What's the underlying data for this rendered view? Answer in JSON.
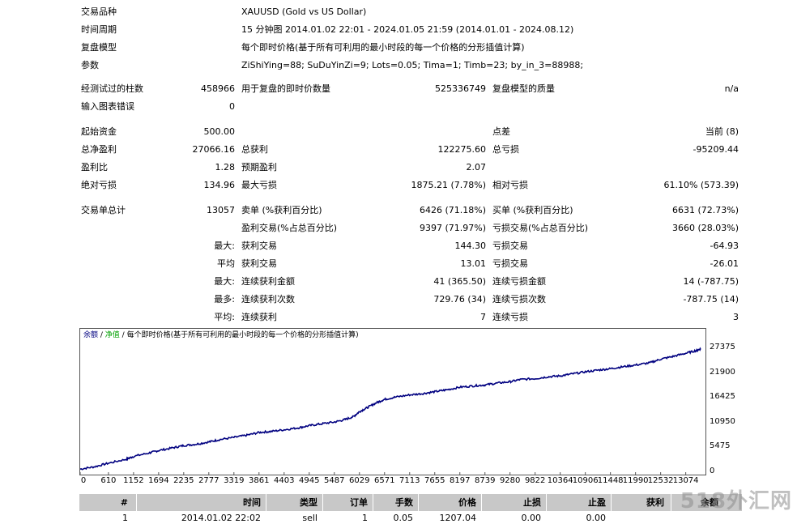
{
  "header": {
    "symbol_label": "交易品种",
    "symbol_value": "XAUUSD (Gold vs US Dollar)",
    "period_label": "时间周期",
    "period_value": "15 分钟图 2014.01.02 22:01 - 2024.01.05 21:59 (2014.01.01 - 2024.08.12)",
    "model_label": "复盘模型",
    "model_value": "每个即时价格(基于所有可利用的最小时段的每一个价格的分形插值计算)",
    "params_label": "参数",
    "params_value": "ZiShiYing=88; SuDuYinZi=9; Lots=0.05; Tima=1; Timb=23; by_in_3=88988;"
  },
  "stats": {
    "bars_label": "经测试过的柱数",
    "bars_value": "458966",
    "ticks_label": "用于复盘的即时价数量",
    "ticks_value": "525336749",
    "quality_label": "复盘模型的质量",
    "quality_value": "n/a",
    "errors_label": "输入图表错误",
    "errors_value": "0",
    "deposit_label": "起始资金",
    "deposit_value": "500.00",
    "spread_label": "点差",
    "spread_value": "当前 (8)",
    "netprofit_label": "总净盈利",
    "netprofit_value": "27066.16",
    "grossprofit_label": "总获利",
    "grossprofit_value": "122275.60",
    "grossloss_label": "总亏损",
    "grossloss_value": "-95209.44",
    "pf_label": "盈利比",
    "pf_value": "1.28",
    "expected_label": "预期盈利",
    "expected_value": "2.07",
    "absdd_label": "绝对亏损",
    "absdd_value": "134.96",
    "maxdd_label": "最大亏损",
    "maxdd_value": "1875.21 (7.78%)",
    "reldd_label": "相对亏损",
    "reldd_value": "61.10% (573.39)",
    "trades_label": "交易单总计",
    "trades_value": "13057",
    "short_label": "卖单 (%获利百分比)",
    "short_value": "6426 (71.18%)",
    "long_label": "买单 (%获利百分比)",
    "long_value": "6631 (72.73%)",
    "win_label": "盈利交易(%占总百分比)",
    "win_value": "9397 (71.97%)",
    "loss_label": "亏损交易(%占总百分比)",
    "loss_value": "3660 (28.03%)",
    "largest_prefix": "最大:",
    "largest_win_label": "获利交易",
    "largest_win_value": "144.30",
    "largest_loss_label": "亏损交易",
    "largest_loss_value": "-64.93",
    "avg_prefix": "平均",
    "avg_win_label": "获利交易",
    "avg_win_value": "13.01",
    "avg_loss_label": "亏损交易",
    "avg_loss_value": "-26.01",
    "maxcons_prefix": "最大:",
    "maxcons_win_label": "连续获利金额",
    "maxcons_win_value": "41 (365.50)",
    "maxcons_loss_label": "连续亏损金额",
    "maxcons_loss_value": "14 (-787.75)",
    "maxconsamt_prefix": "最多:",
    "maxconsamt_win_label": "连续获利次数",
    "maxconsamt_win_value": "729.76 (34)",
    "maxconsamt_loss_label": "连续亏损次数",
    "maxconsamt_loss_value": "-787.75 (14)",
    "avgcons_prefix": "平均:",
    "avgcons_win_label": "连续获利",
    "avgcons_win_value": "7",
    "avgcons_loss_label": "连续亏损",
    "avgcons_loss_value": "3"
  },
  "chart_data": {
    "type": "line",
    "legend": {
      "balance": "余额",
      "sep1": " / ",
      "equity": "净值",
      "sep2": " / ",
      "model": "每个即时价格(基于所有可利用的最小时段的每一个价格的分形插值计算)"
    },
    "balance_color": "#000080",
    "equity_color": "#00a000",
    "ylim": [
      0,
      29000
    ],
    "xlim": [
      0,
      13500
    ],
    "y_ticks": [
      "27375",
      "21900",
      "16425",
      "10950",
      "5475",
      "0"
    ],
    "y_tick_values": [
      27375,
      21900,
      16425,
      10950,
      5475,
      0
    ],
    "x_ticks": [
      "0",
      "610",
      "1152",
      "1694",
      "2235",
      "2777",
      "3319",
      "3861",
      "4403",
      "4945",
      "5487",
      "6029",
      "6571",
      "7113",
      "7655",
      "8197",
      "8739",
      "9280",
      "9822",
      "10364",
      "10906",
      "11448",
      "11990",
      "12532",
      "13074"
    ],
    "series": [
      {
        "x": [
          0,
          300,
          610,
          1000,
          1152,
          1500,
          1694,
          2000,
          2235,
          2500,
          2777,
          3000,
          3319,
          3600,
          3861,
          4100,
          4403,
          4700,
          4945,
          5200,
          5487,
          5700,
          5900,
          6029,
          6200,
          6400,
          6571,
          6800,
          7113,
          7400,
          7655,
          7900,
          8197,
          8500,
          8739,
          9000,
          9280,
          9500,
          9822,
          10100,
          10364,
          10600,
          10906,
          11200,
          11448,
          11700,
          11990,
          12300,
          12532,
          12800,
          13074,
          13300,
          13400
        ],
        "y": [
          500,
          1000,
          1800,
          2700,
          3300,
          4100,
          4600,
          5200,
          5700,
          6000,
          6500,
          7000,
          7500,
          8000,
          8600,
          8800,
          9200,
          9600,
          10100,
          10500,
          10900,
          11400,
          12100,
          13200,
          14100,
          15200,
          15900,
          16400,
          16900,
          17200,
          17600,
          18000,
          18600,
          18900,
          19100,
          19500,
          19800,
          20300,
          20500,
          20900,
          21100,
          21500,
          22000,
          22400,
          22700,
          23100,
          23500,
          24000,
          24800,
          25400,
          26100,
          26700,
          27100
        ]
      }
    ]
  },
  "table": {
    "headers": [
      "#",
      "时间",
      "类型",
      "订单",
      "手数",
      "价格",
      "止损",
      "止盈",
      "获利",
      "余额"
    ],
    "row": [
      "1",
      "2014.01.02 22:02",
      "sell",
      "1",
      "0.05",
      "1207.04",
      "0.00",
      "0.00",
      "",
      ""
    ]
  },
  "watermark": "518外汇网"
}
